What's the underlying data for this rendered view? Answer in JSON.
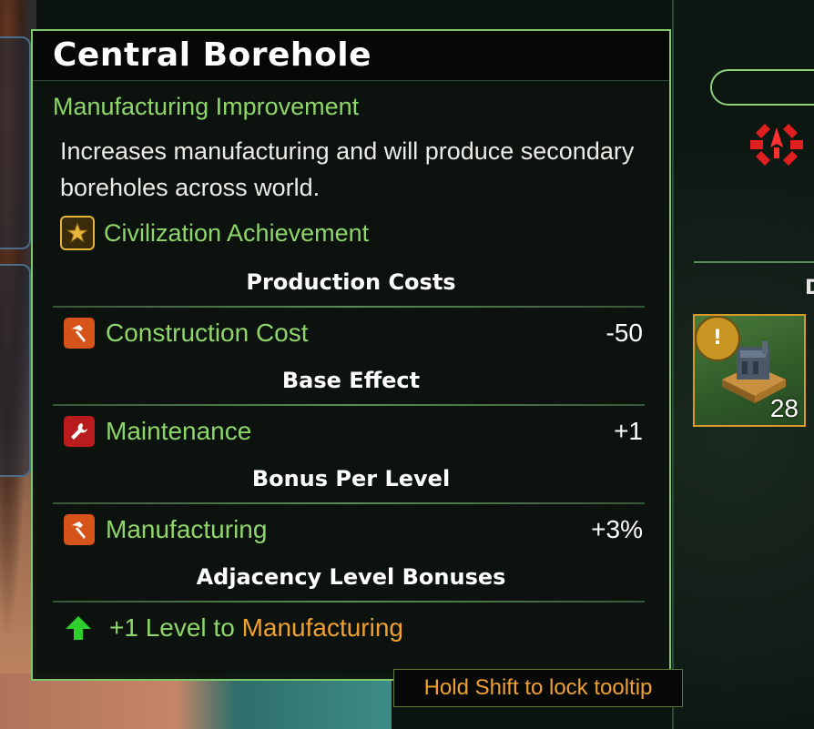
{
  "tooltip": {
    "title": "Central Borehole",
    "category": "Manufacturing Improvement",
    "description": "Increases manufacturing and will produce secondary boreholes across world.",
    "achievement": "Civilization Achievement",
    "sections": {
      "production_costs": "Production Costs",
      "base_effect": "Base Effect",
      "bonus_per_level": "Bonus Per Level",
      "adjacency": "Adjacency Level Bonuses"
    },
    "construction_cost": {
      "label": "Construction Cost",
      "value": "-50",
      "icon": "hammer-icon"
    },
    "maintenance": {
      "label": "Maintenance",
      "value": "+1",
      "icon": "wrench-icon"
    },
    "manufacturing": {
      "label": "Manufacturing",
      "value": "+3%",
      "icon": "hammer-icon"
    },
    "adjacency_bonus": {
      "prefix": "+1 Level to ",
      "target": "Manufacturing",
      "icon": "green-up-arrow-icon"
    }
  },
  "lock_hint": "Hold Shift to lock tooltip",
  "side_panel": {
    "building_count": "28",
    "badge_icon": "!",
    "partial_text": "D"
  },
  "colors": {
    "accent_green": "#8fd66a",
    "accent_orange": "#f0a030",
    "border_green": "#7fc86a",
    "alert_red": "#e02020"
  }
}
